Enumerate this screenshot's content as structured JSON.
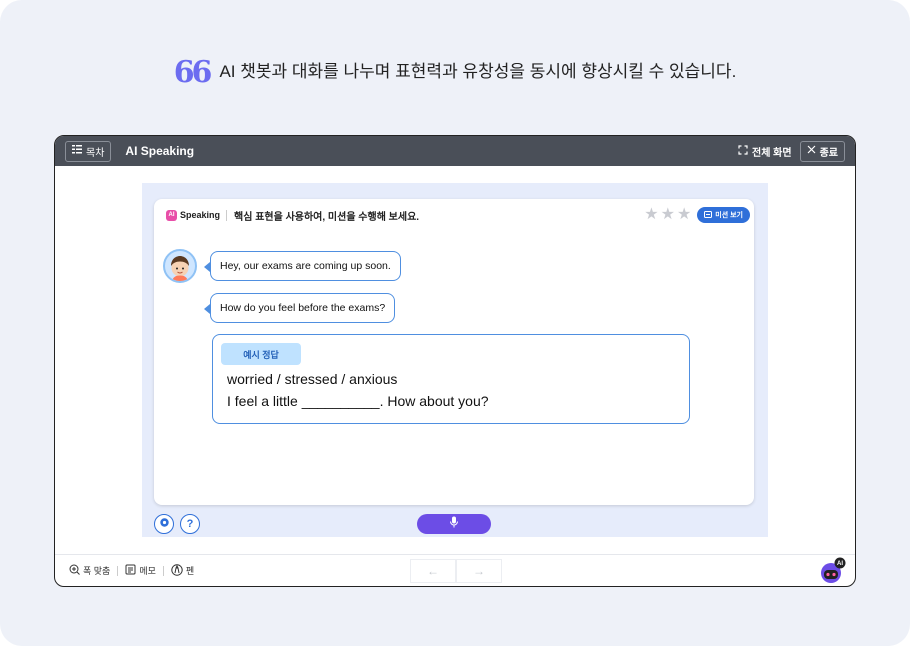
{
  "caption": {
    "quote": "66",
    "text": "AI 챗봇과 대화를 나누며 표현력과 유창성을 동시에 향상시킬 수 있습니다."
  },
  "titlebar": {
    "toc_label": "목차",
    "title": "AI Speaking",
    "fullscreen_label": "전체 화면",
    "close_label": "종료"
  },
  "card": {
    "logo_badge": "AI",
    "logo_text": "Speaking",
    "instruction": "핵심 표현을 사용하여, 미션을 수행해 보세요.",
    "rating": {
      "earned": 0,
      "total": 3
    },
    "mission_label": "미션 보기"
  },
  "chat": {
    "messages": [
      "Hey, our exams are coming up soon.",
      "How do you feel before the exams?"
    ]
  },
  "answer": {
    "tag": "예시 정답",
    "line1": "worried / stressed / anxious",
    "line2": "I feel a little __________. How about you?"
  },
  "controls": {
    "help_glyph": "?"
  },
  "bottombar": {
    "fit_label": "폭 맞춤",
    "memo_label": "메모",
    "pen_label": "펜",
    "prev_glyph": "←",
    "next_glyph": "→",
    "ai_badge": "AI"
  },
  "colors": {
    "accent": "#2f6fd9",
    "mic": "#6c4de6",
    "titlebar": "#4a4f58",
    "stage": "#e6ecfb"
  }
}
